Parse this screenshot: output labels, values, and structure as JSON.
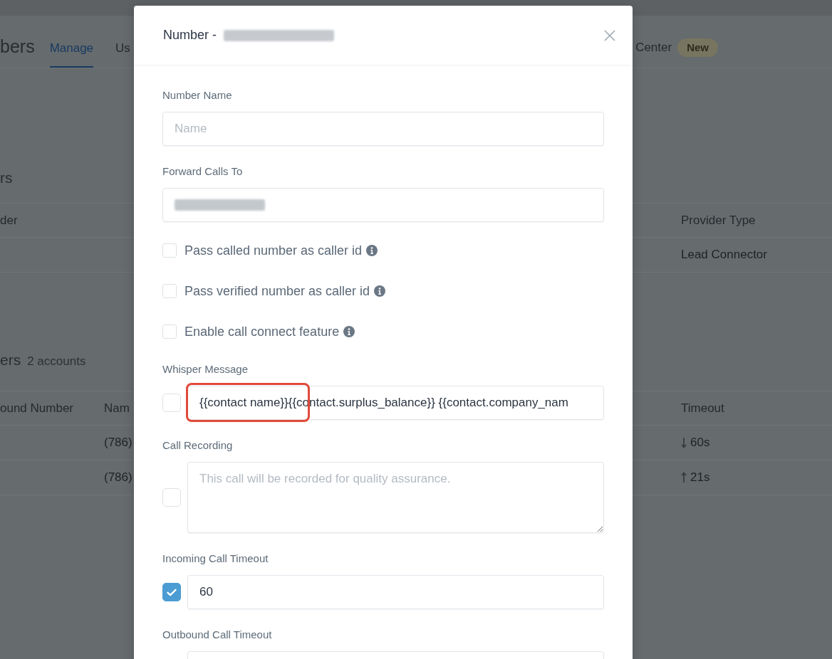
{
  "background_page": {
    "title": "bers",
    "tabs": [
      {
        "label": "Manage",
        "selected": true
      },
      {
        "label": "Us",
        "selected": false
      },
      {
        "label": "Center",
        "selected": false,
        "badge": "New"
      }
    ],
    "sections": [
      {
        "heading": "rs",
        "columns": {
          "column_1": "der",
          "column_3": "Provider Type"
        },
        "rows": [
          {
            "column_3": "Lead Connector"
          }
        ]
      },
      {
        "heading": "ers",
        "count": "2 accounts",
        "columns": {
          "column_1": "ound Number",
          "column_2": "Nam",
          "column_3": "Timeout"
        },
        "rows": [
          {
            "kind": "down",
            "column_2": "(786)",
            "column_3": "60s"
          },
          {
            "kind": "up",
            "column_2": "(786)",
            "column_3": "21s"
          }
        ]
      }
    ]
  },
  "modal": {
    "title": "Number -",
    "title_redacted": true,
    "fields": [
      {
        "kind": "text",
        "label": "Number Name",
        "placeholder": "Name"
      },
      {
        "kind": "text",
        "label": "Forward Calls To",
        "redacted": true
      },
      {
        "kind": "checkbox",
        "label": "Pass called number as caller id",
        "checked": false,
        "info": true
      },
      {
        "kind": "checkbox",
        "label": "Pass verified number as caller id",
        "checked": false,
        "info": true
      },
      {
        "kind": "checkbox",
        "label": "Enable call connect feature",
        "checked": false,
        "info": true
      },
      {
        "kind": "toggle_text",
        "label": "Whisper Message",
        "checked": false,
        "value": "{{contact name}}{{contact.surplus_balance}} {{contact.company_nam",
        "highlighted": true
      },
      {
        "kind": "toggle_textarea",
        "label": "Call Recording",
        "checked": false,
        "placeholder": "This call will be recorded for quality assurance."
      },
      {
        "kind": "toggle_text",
        "label": "Incoming Call Timeout",
        "checked": true,
        "value": "60"
      },
      {
        "kind": "toggle_text",
        "label": "Outbound Call Timeout"
      }
    ]
  }
}
